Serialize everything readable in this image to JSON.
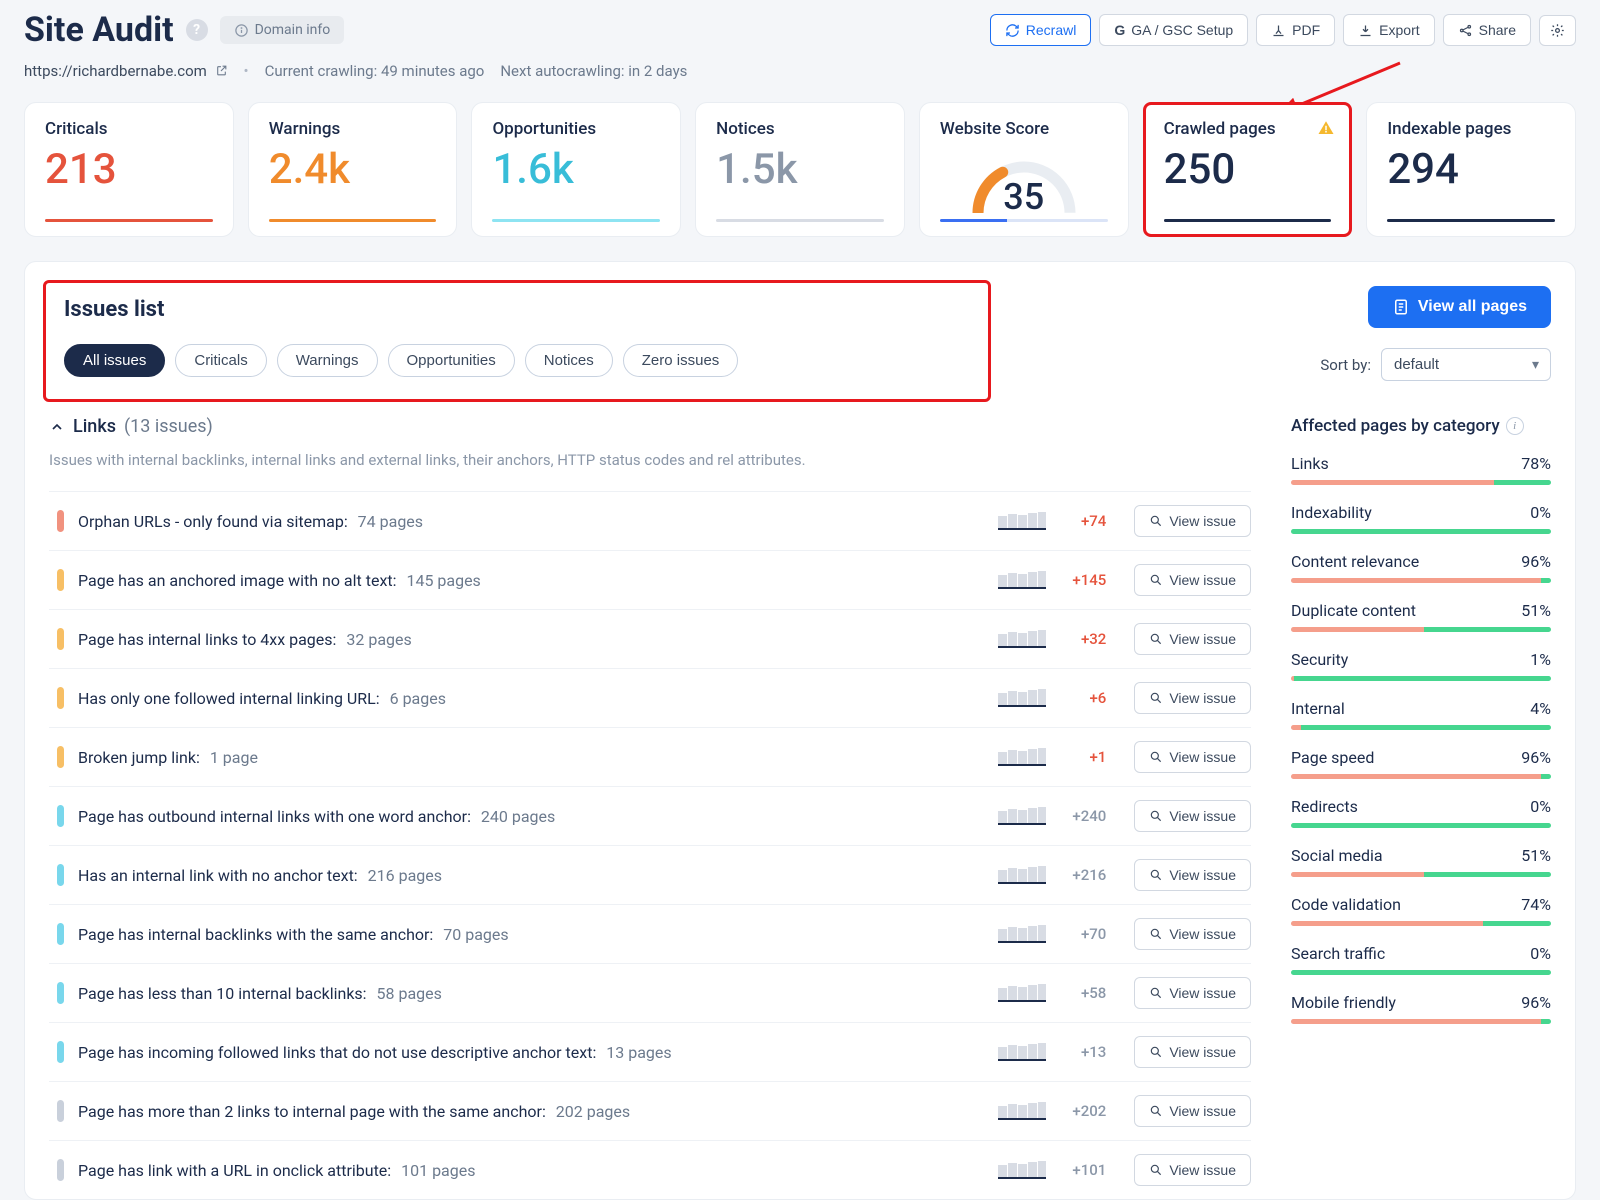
{
  "header": {
    "title": "Site Audit",
    "domain_info": "Domain info",
    "buttons": {
      "recrawl": "Recrawl",
      "ga_gsc": "GA / GSC Setup",
      "pdf": "PDF",
      "export": "Export",
      "share": "Share"
    },
    "url": "https://richardbernabe.com",
    "crawl_status": "Current crawling: 49 minutes ago",
    "next_crawl": "Next autocrawling: in 2 days"
  },
  "stats": [
    {
      "label": "Criticals",
      "value": "213",
      "color": "c-red",
      "underline": "u-red"
    },
    {
      "label": "Warnings",
      "value": "2.4k",
      "color": "c-orange",
      "underline": "u-orange"
    },
    {
      "label": "Opportunities",
      "value": "1.6k",
      "color": "c-teal",
      "underline": "u-teal"
    },
    {
      "label": "Notices",
      "value": "1.5k",
      "color": "c-gray",
      "underline": "u-gray"
    },
    {
      "label": "Website Score",
      "value": "35",
      "is_gauge": true
    },
    {
      "label": "Crawled pages",
      "value": "250",
      "color": "c-navy",
      "underline": "u-navy",
      "highlight": true,
      "warn": true
    },
    {
      "label": "Indexable pages",
      "value": "294",
      "color": "c-navy",
      "underline": "u-navy"
    }
  ],
  "issues": {
    "title": "Issues list",
    "pills": [
      "All issues",
      "Criticals",
      "Warnings",
      "Opportunities",
      "Notices",
      "Zero issues"
    ],
    "active_pill": 0,
    "view_all": "View all pages",
    "sort_label": "Sort by:",
    "sort_value": "default",
    "group_title": "Links",
    "group_count": "(13 issues)",
    "group_desc": "Issues with internal backlinks, internal links and external links, their anchors, HTTP status codes and rel attributes.",
    "list": [
      {
        "sev": "red",
        "name": "Orphan URLs - only found via sitemap:",
        "pg": "74 pages",
        "delta": "+74",
        "delta_c": "red"
      },
      {
        "sev": "orange",
        "name": "Page has an anchored image with no alt text:",
        "pg": "145 pages",
        "delta": "+145",
        "delta_c": "red"
      },
      {
        "sev": "orange",
        "name": "Page has internal links to 4xx pages:",
        "pg": "32 pages",
        "delta": "+32",
        "delta_c": "red"
      },
      {
        "sev": "orange",
        "name": "Has only one followed internal linking URL:",
        "pg": "6 pages",
        "delta": "+6",
        "delta_c": "red"
      },
      {
        "sev": "orange",
        "name": "Broken jump link:",
        "pg": "1 page",
        "delta": "+1",
        "delta_c": "red"
      },
      {
        "sev": "teal",
        "name": "Page has outbound internal links with one word anchor:",
        "pg": "240 pages",
        "delta": "+240",
        "delta_c": "gray"
      },
      {
        "sev": "teal",
        "name": "Has an internal link with no anchor text:",
        "pg": "216 pages",
        "delta": "+216",
        "delta_c": "gray"
      },
      {
        "sev": "teal",
        "name": "Page has internal backlinks with the same anchor:",
        "pg": "70 pages",
        "delta": "+70",
        "delta_c": "gray"
      },
      {
        "sev": "teal",
        "name": "Page has less than 10 internal backlinks:",
        "pg": "58 pages",
        "delta": "+58",
        "delta_c": "gray"
      },
      {
        "sev": "teal",
        "name": "Page has incoming followed links that do not use descriptive anchor text:",
        "pg": "13 pages",
        "delta": "+13",
        "delta_c": "gray"
      },
      {
        "sev": "gray",
        "name": "Page has more than 2 links to internal page with the same anchor:",
        "pg": "202 pages",
        "delta": "+202",
        "delta_c": "gray"
      },
      {
        "sev": "gray",
        "name": "Page has link with a URL in onclick attribute:",
        "pg": "101 pages",
        "delta": "+101",
        "delta_c": "gray"
      }
    ],
    "view_issue": "View issue"
  },
  "categories": {
    "title": "Affected pages by category",
    "items": [
      {
        "name": "Links",
        "pct": 78
      },
      {
        "name": "Indexability",
        "pct": 0
      },
      {
        "name": "Content relevance",
        "pct": 96
      },
      {
        "name": "Duplicate content",
        "pct": 51
      },
      {
        "name": "Security",
        "pct": 1
      },
      {
        "name": "Internal",
        "pct": 4
      },
      {
        "name": "Page speed",
        "pct": 96
      },
      {
        "name": "Redirects",
        "pct": 0
      },
      {
        "name": "Social media",
        "pct": 51
      },
      {
        "name": "Code validation",
        "pct": 74
      },
      {
        "name": "Search traffic",
        "pct": 0
      },
      {
        "name": "Mobile friendly",
        "pct": 96
      }
    ]
  }
}
